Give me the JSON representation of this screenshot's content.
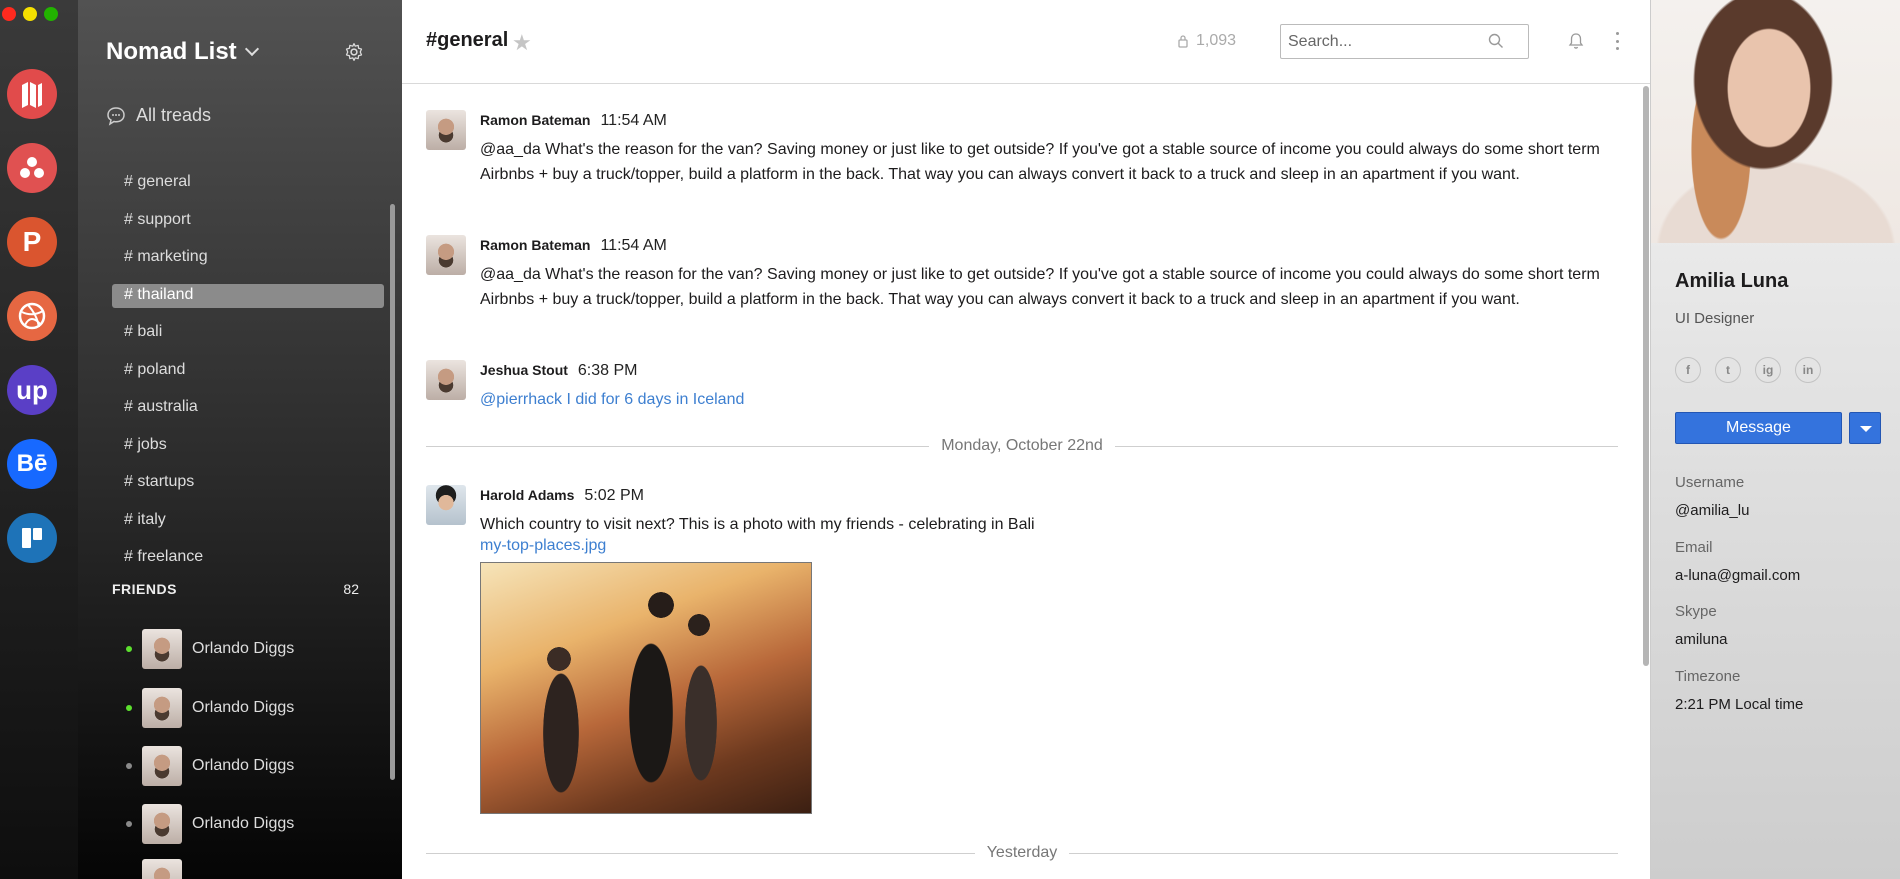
{
  "workspace": {
    "name": "Nomad List",
    "all_threads": "All treads"
  },
  "channels": [
    {
      "label": "# general",
      "active": false
    },
    {
      "label": "# support",
      "active": false
    },
    {
      "label": "# marketing",
      "active": false
    },
    {
      "label": "# thailand",
      "active": true
    },
    {
      "label": "# bali",
      "active": false
    },
    {
      "label": "# poland",
      "active": false
    },
    {
      "label": "# australia",
      "active": false
    },
    {
      "label": "# jobs",
      "active": false
    },
    {
      "label": "# startups",
      "active": false
    },
    {
      "label": "# italy",
      "active": false
    },
    {
      "label": "# freelance",
      "active": false
    }
  ],
  "friends": {
    "title": "FRIENDS",
    "count": "82",
    "list": [
      {
        "name": "Orlando Diggs",
        "online": true
      },
      {
        "name": "Orlando Diggs",
        "online": true
      },
      {
        "name": "Orlando Diggs",
        "online": false
      },
      {
        "name": "Orlando Diggs",
        "online": false
      }
    ]
  },
  "apps": [
    {
      "name": "nomad-list-app",
      "glyph": "",
      "color": "#e14b4b"
    },
    {
      "name": "teamwork-app",
      "glyph": "",
      "color": "#e05151"
    },
    {
      "name": "product-hunt-app",
      "glyph": "P",
      "color": "#da552f"
    },
    {
      "name": "dribbble-app",
      "glyph": "",
      "color": "#e66742"
    },
    {
      "name": "upwork-app",
      "glyph": "up",
      "color": "#5a3fc6"
    },
    {
      "name": "behance-app",
      "glyph": "Bē",
      "color": "#1769ff"
    },
    {
      "name": "trello-app",
      "glyph": "",
      "color": "#1e73b8"
    }
  ],
  "header": {
    "channel": "#general",
    "members": "1,093",
    "search_placeholder": "Search..."
  },
  "messages": [
    {
      "author": "Ramon Bateman",
      "time": "11:54 AM",
      "text": "@aa_da What's the reason for the van? Saving money or just like to get outside? If you've got a stable source of income you could always do some short term Airbnbs + buy a truck/topper, build a platform in the back. That way you can always convert it back to a truck and sleep in an apartment if you want."
    },
    {
      "author": "Ramon Bateman",
      "time": "11:54 AM",
      "text": "@aa_da What's the reason for the van? Saving money or just like to get outside? If you've got a stable source of income you could always do some short term Airbnbs + buy a truck/topper, build a platform in the back. That way you can always convert it back to a truck and sleep in an apartment if you want."
    },
    {
      "author": "Jeshua Stout",
      "time": "6:38 PM",
      "text": "@pierrhack I did for 6 days in Iceland"
    },
    {
      "author": "Harold Adams",
      "time": "5:02 PM",
      "text": "Which country to visit next? This is a photo with my friends - celebrating in Bali",
      "attachment": "my-top-places.jpg"
    }
  ],
  "dividers": [
    "Monday, October 22nd",
    "Yesterday"
  ],
  "profile": {
    "name": "Amilia Luna",
    "role": "UI Designer",
    "socials": [
      "f",
      "t",
      "ig",
      "in"
    ],
    "message_button": "Message",
    "fields": [
      {
        "label": "Username",
        "value": "@amilia_lu"
      },
      {
        "label": "Email",
        "value": "a-luna@gmail.com"
      },
      {
        "label": "Skype",
        "value": "amiluna"
      },
      {
        "label": "Timezone",
        "value": "2:21 PM Local time"
      }
    ]
  }
}
